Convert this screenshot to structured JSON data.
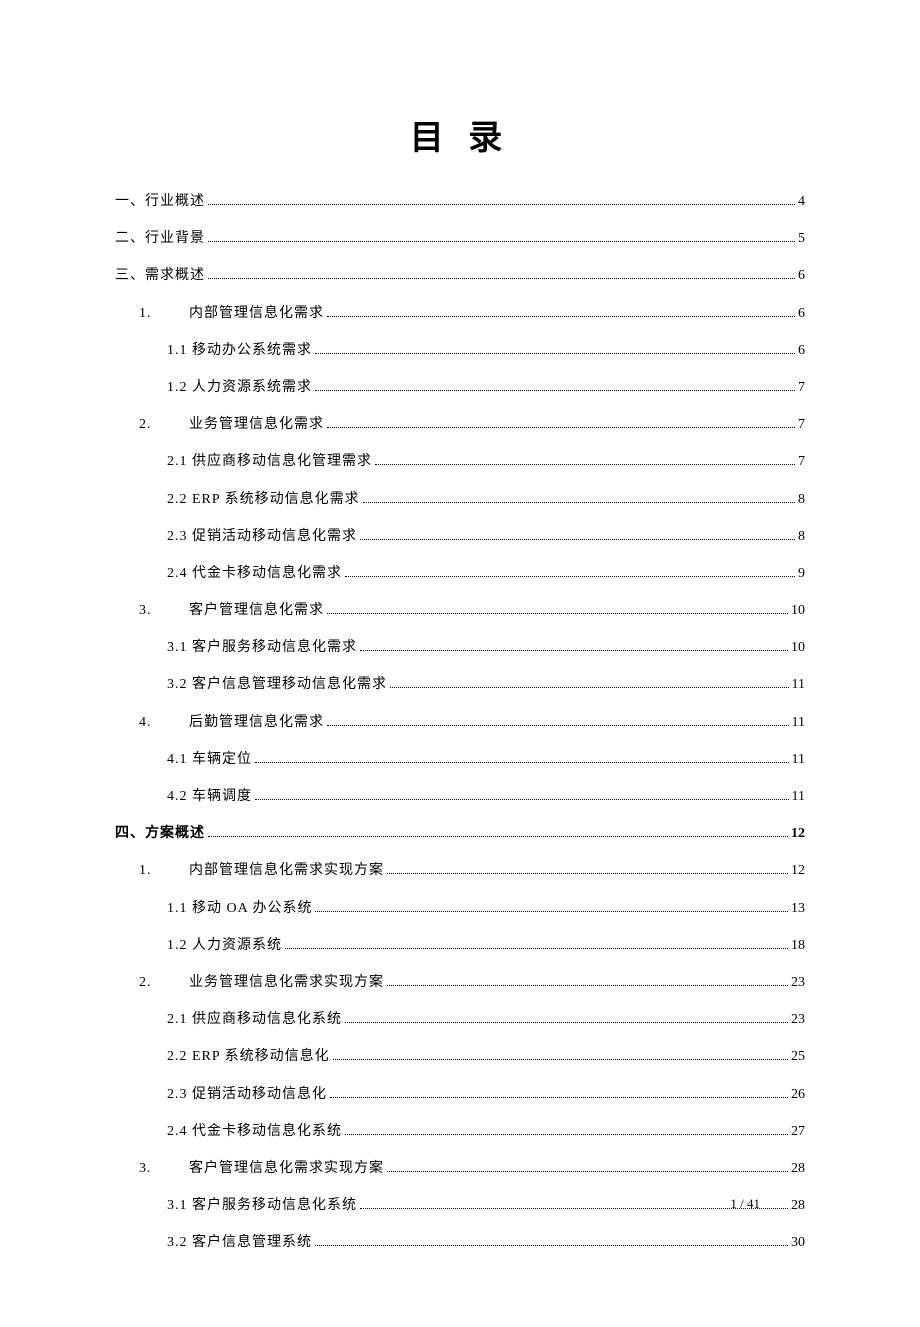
{
  "title": "目 录",
  "footer": "1 / 41",
  "entries": [
    {
      "label": "一、行业概述",
      "page": "4",
      "indent": 0,
      "bold": false
    },
    {
      "label": "二、行业背景",
      "page": "5",
      "indent": 0,
      "bold": false
    },
    {
      "label": "三、需求概述",
      "page": "6",
      "indent": 0,
      "bold": false
    },
    {
      "num": "1.",
      "label": "内部管理信息化需求",
      "page": "6",
      "indent": 1,
      "bold": false
    },
    {
      "label": "1.1 移动办公系统需求",
      "page": "6",
      "indent": 2,
      "bold": false
    },
    {
      "label": "1.2 人力资源系统需求",
      "page": "7",
      "indent": 2,
      "bold": false
    },
    {
      "num": "2.",
      "label": "业务管理信息化需求",
      "page": "7",
      "indent": 1,
      "bold": false
    },
    {
      "label": "2.1 供应商移动信息化管理需求",
      "page": "7",
      "indent": 2,
      "bold": false
    },
    {
      "label": "2.2 ERP 系统移动信息化需求",
      "page": "8",
      "indent": 2,
      "bold": false
    },
    {
      "label": "2.3 促销活动移动信息化需求",
      "page": "8",
      "indent": 2,
      "bold": false
    },
    {
      "label": "2.4 代金卡移动信息化需求",
      "page": "9",
      "indent": 2,
      "bold": false
    },
    {
      "num": "3.",
      "label": "客户管理信息化需求",
      "page": "10",
      "indent": 1,
      "bold": false
    },
    {
      "label": "3.1 客户服务移动信息化需求",
      "page": "10",
      "indent": 2,
      "bold": false
    },
    {
      "label": "3.2 客户信息管理移动信息化需求",
      "page": "11",
      "indent": 2,
      "bold": false
    },
    {
      "num": "4.",
      "label": "后勤管理信息化需求",
      "page": "11",
      "indent": 1,
      "bold": false
    },
    {
      "label": "4.1 车辆定位",
      "page": "11",
      "indent": 2,
      "bold": false
    },
    {
      "label": "4.2 车辆调度",
      "page": "11",
      "indent": 2,
      "bold": false
    },
    {
      "label": "四、方案概述",
      "page": "12",
      "indent": 0,
      "bold": true
    },
    {
      "num": "1.",
      "label": "内部管理信息化需求实现方案",
      "page": "12",
      "indent": 1,
      "bold": false
    },
    {
      "label": "1.1  移动 OA 办公系统",
      "page": "13",
      "indent": 2,
      "bold": false
    },
    {
      "label": "1.2 人力资源系统",
      "page": "18",
      "indent": 2,
      "bold": false
    },
    {
      "num": "2.",
      "label": "业务管理信息化需求实现方案",
      "page": "23",
      "indent": 1,
      "bold": false
    },
    {
      "label": "2.1 供应商移动信息化系统",
      "page": "23",
      "indent": 2,
      "bold": false
    },
    {
      "label": "2.2 ERP 系统移动信息化",
      "page": "25",
      "indent": 2,
      "bold": false
    },
    {
      "label": "2.3 促销活动移动信息化",
      "page": "26",
      "indent": 2,
      "bold": false
    },
    {
      "label": "2.4 代金卡移动信息化系统",
      "page": "27",
      "indent": 2,
      "bold": false
    },
    {
      "num": "3.",
      "label": "客户管理信息化需求实现方案",
      "page": "28",
      "indent": 1,
      "bold": false
    },
    {
      "label": "3.1 客户服务移动信息化系统",
      "page": "28",
      "indent": 2,
      "bold": false
    },
    {
      "label": "3.2 客户信息管理系统",
      "page": "30",
      "indent": 2,
      "bold": false
    }
  ]
}
